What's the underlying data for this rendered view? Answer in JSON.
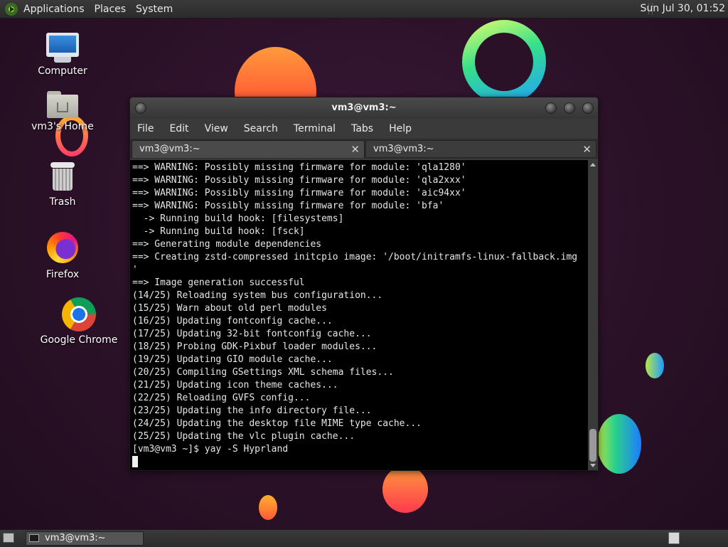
{
  "top_panel": {
    "menus": [
      "Applications",
      "Places",
      "System"
    ],
    "clock": "Sun Jul 30, 01:52"
  },
  "desktop_icons": [
    {
      "label": "Computer",
      "icon": "computer-icon"
    },
    {
      "label": "vm3's Home",
      "icon": "home-folder-icon"
    },
    {
      "label": "Trash",
      "icon": "trash-icon"
    },
    {
      "label": "Firefox",
      "icon": "firefox-icon"
    },
    {
      "label": "Google Chrome",
      "icon": "chrome-icon"
    }
  ],
  "terminal": {
    "title": "vm3@vm3:~",
    "menu": [
      "File",
      "Edit",
      "View",
      "Search",
      "Terminal",
      "Tabs",
      "Help"
    ],
    "tabs": [
      {
        "label": "vm3@vm3:~",
        "active": true
      },
      {
        "label": "vm3@vm3:~",
        "active": false
      }
    ],
    "lines": [
      "==> WARNING: Possibly missing firmware for module: 'qla1280'",
      "==> WARNING: Possibly missing firmware for module: 'qla2xxx'",
      "==> WARNING: Possibly missing firmware for module: 'aic94xx'",
      "==> WARNING: Possibly missing firmware for module: 'bfa'",
      "  -> Running build hook: [filesystems]",
      "  -> Running build hook: [fsck]",
      "==> Generating module dependencies",
      "==> Creating zstd-compressed initcpio image: '/boot/initramfs-linux-fallback.img",
      "'",
      "==> Image generation successful",
      "(14/25) Reloading system bus configuration...",
      "(15/25) Warn about old perl modules",
      "(16/25) Updating fontconfig cache...",
      "(17/25) Updating 32-bit fontconfig cache...",
      "(18/25) Probing GDK-Pixbuf loader modules...",
      "(19/25) Updating GIO module cache...",
      "(20/25) Compiling GSettings XML schema files...",
      "(21/25) Updating icon theme caches...",
      "(22/25) Reloading GVFS config...",
      "(23/25) Updating the info directory file...",
      "(24/25) Updating the desktop file MIME type cache...",
      "(25/25) Updating the vlc plugin cache...",
      "[vm3@vm3 ~]$ yay -S Hyprland"
    ]
  },
  "taskbar": {
    "window_button": "vm3@vm3:~"
  },
  "colors": {
    "panel": "#2f2f2f",
    "terminal_bg": "#000000",
    "terminal_fg": "#e6e6e6",
    "desktop_bg": "#2b1128"
  }
}
